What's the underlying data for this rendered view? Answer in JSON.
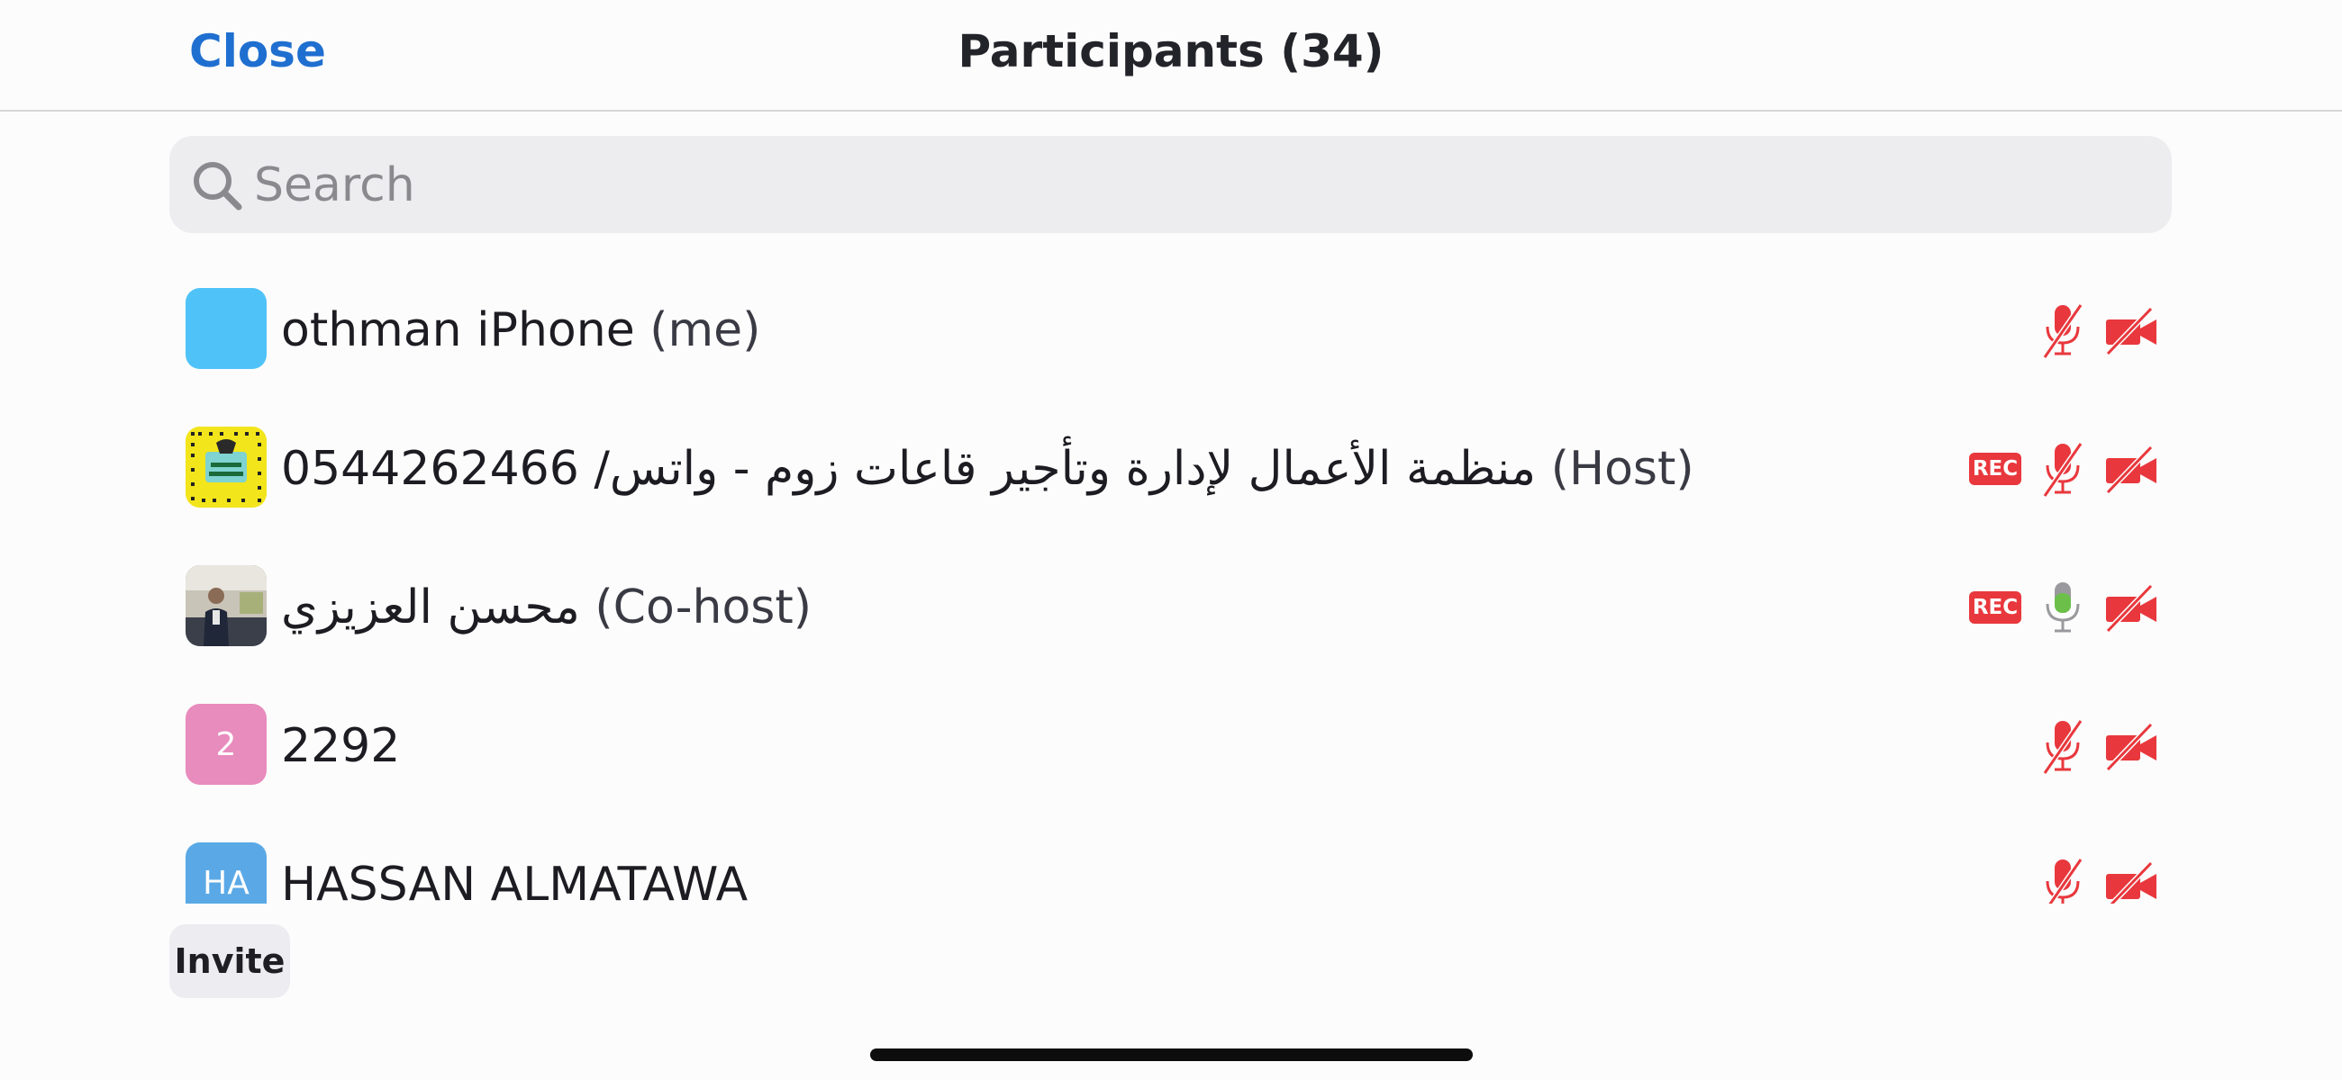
{
  "header": {
    "close_label": "Close",
    "title": "Participants (34)"
  },
  "search": {
    "placeholder": "Search",
    "value": ""
  },
  "participants": [
    {
      "name": "othman iPhone",
      "role": "(me)",
      "avatar_initials": "",
      "avatar_color": "#4fc3f7",
      "avatar_kind": "plain",
      "rec": false,
      "mic": "muted",
      "video": "off"
    },
    {
      "name": "منظمة الأعمال لإدارة وتأجير قاعات زوم - واتس/ 0544262466",
      "role": "(Host)",
      "avatar_initials": "",
      "avatar_color": "#f2e51c",
      "avatar_kind": "snapcode",
      "rec": true,
      "rec_label": "REC",
      "mic": "muted",
      "video": "off"
    },
    {
      "name": "محسن العزيزي",
      "role": "(Co-host)",
      "avatar_initials": "",
      "avatar_color": "#4a5568",
      "avatar_kind": "photo",
      "rec": true,
      "rec_label": "REC",
      "mic": "on",
      "video": "off"
    },
    {
      "name": "2292",
      "role": "",
      "avatar_initials": "2",
      "avatar_color": "#e88bbd",
      "avatar_kind": "initials",
      "rec": false,
      "mic": "muted",
      "video": "off"
    },
    {
      "name": "HASSAN ALMATAWA",
      "role": "",
      "avatar_initials": "HA",
      "avatar_color": "#5aa9e6",
      "avatar_kind": "initials",
      "rec": false,
      "mic": "muted",
      "video": "off"
    }
  ],
  "footer": {
    "invite_label": "Invite"
  },
  "colors": {
    "accent": "#1f6fd0",
    "muted_red": "#e8383d",
    "mic_on_green": "#6cc04a"
  }
}
